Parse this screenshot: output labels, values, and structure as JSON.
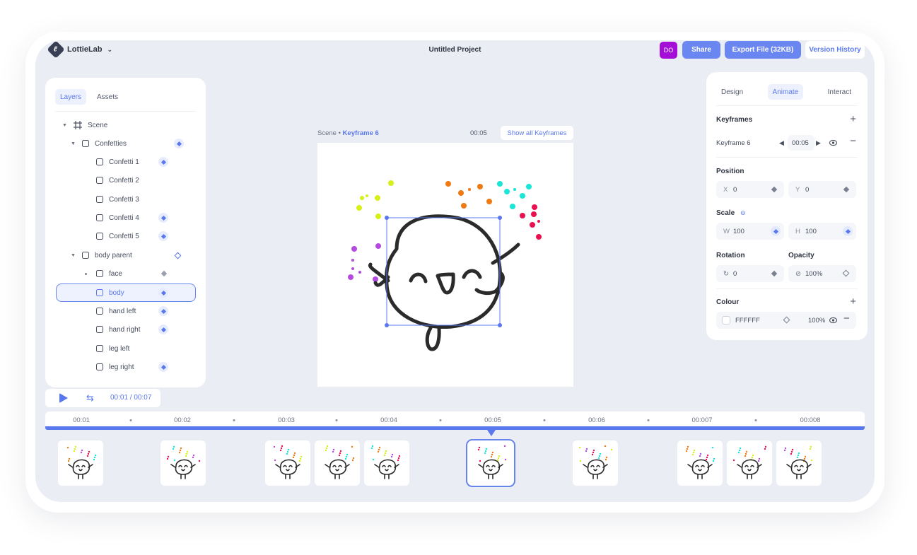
{
  "app": {
    "brand": "LottieLab",
    "brand_logo_letter": "ℓ",
    "brand_chevron": "⌄",
    "project_title": "Untitled Project",
    "avatar_initials": "DO",
    "share_label": "Share",
    "export_label": "Export File (32KB)",
    "history_label": "Version History"
  },
  "layers_panel": {
    "tabs": [
      {
        "label": "Layers",
        "active": true
      },
      {
        "label": "Assets",
        "active": false
      }
    ],
    "items": [
      {
        "label": "Scene"
      },
      {
        "label": "Confetties"
      },
      {
        "label": "Confetti 1"
      },
      {
        "label": "Confetti 2"
      },
      {
        "label": "Confetti 3"
      },
      {
        "label": "Confetti 4"
      },
      {
        "label": "Confetti 5"
      },
      {
        "label": "body parent"
      },
      {
        "label": "face"
      },
      {
        "label": "body",
        "selected": true
      },
      {
        "label": "hand left"
      },
      {
        "label": "hand right"
      },
      {
        "label": "leg left"
      },
      {
        "label": "leg right"
      }
    ]
  },
  "playback": {
    "time": "00:01 / 00:07",
    "play_icon": "play-icon",
    "loop_icon": "loop-icon"
  },
  "scene": {
    "crumb_prefix": "Scene •",
    "crumb_keyframe": "Keyframe 6",
    "time": "00:05",
    "show_all_label": "Show all Keyframes"
  },
  "properties": {
    "tabs": [
      {
        "label": "Design",
        "active": false
      },
      {
        "label": "Animate",
        "active": true
      },
      {
        "label": "Interact",
        "active": false
      }
    ],
    "keyframes_title": "Keyframes",
    "add_symbol": "+",
    "remove_symbol": "−",
    "keyframe_name": "Keyframe 6",
    "keyframe_time": "00:05",
    "position_title": "Position",
    "x_label": "X",
    "x_value": "0",
    "y_label": "Y",
    "y_value": "0",
    "scale_title": "Scale",
    "w_label": "W",
    "w_value": "100",
    "h_label": "H",
    "h_value": "100",
    "rotation_title": "Rotation",
    "rotation_value": "0",
    "opacity_title": "Opacity",
    "opacity_value": "100%",
    "colour_title": "Colour",
    "colour_hex": "FFFFFF",
    "colour_opacity": "100%"
  },
  "timeline": {
    "ticks": [
      "00:01",
      "00:02",
      "00:03",
      "00:04",
      "00:05",
      "00:06",
      "00:007",
      "00:008"
    ],
    "current": "00:05"
  },
  "colors": {
    "accent": "#5a78ee",
    "export_button": "#6a86f0",
    "avatar": "#a40fd8",
    "panel_bg": "#eaedf3",
    "confetti": [
      "#d8f019",
      "#f07a12",
      "#19e6d6",
      "#e8104e",
      "#b44ae0"
    ]
  }
}
